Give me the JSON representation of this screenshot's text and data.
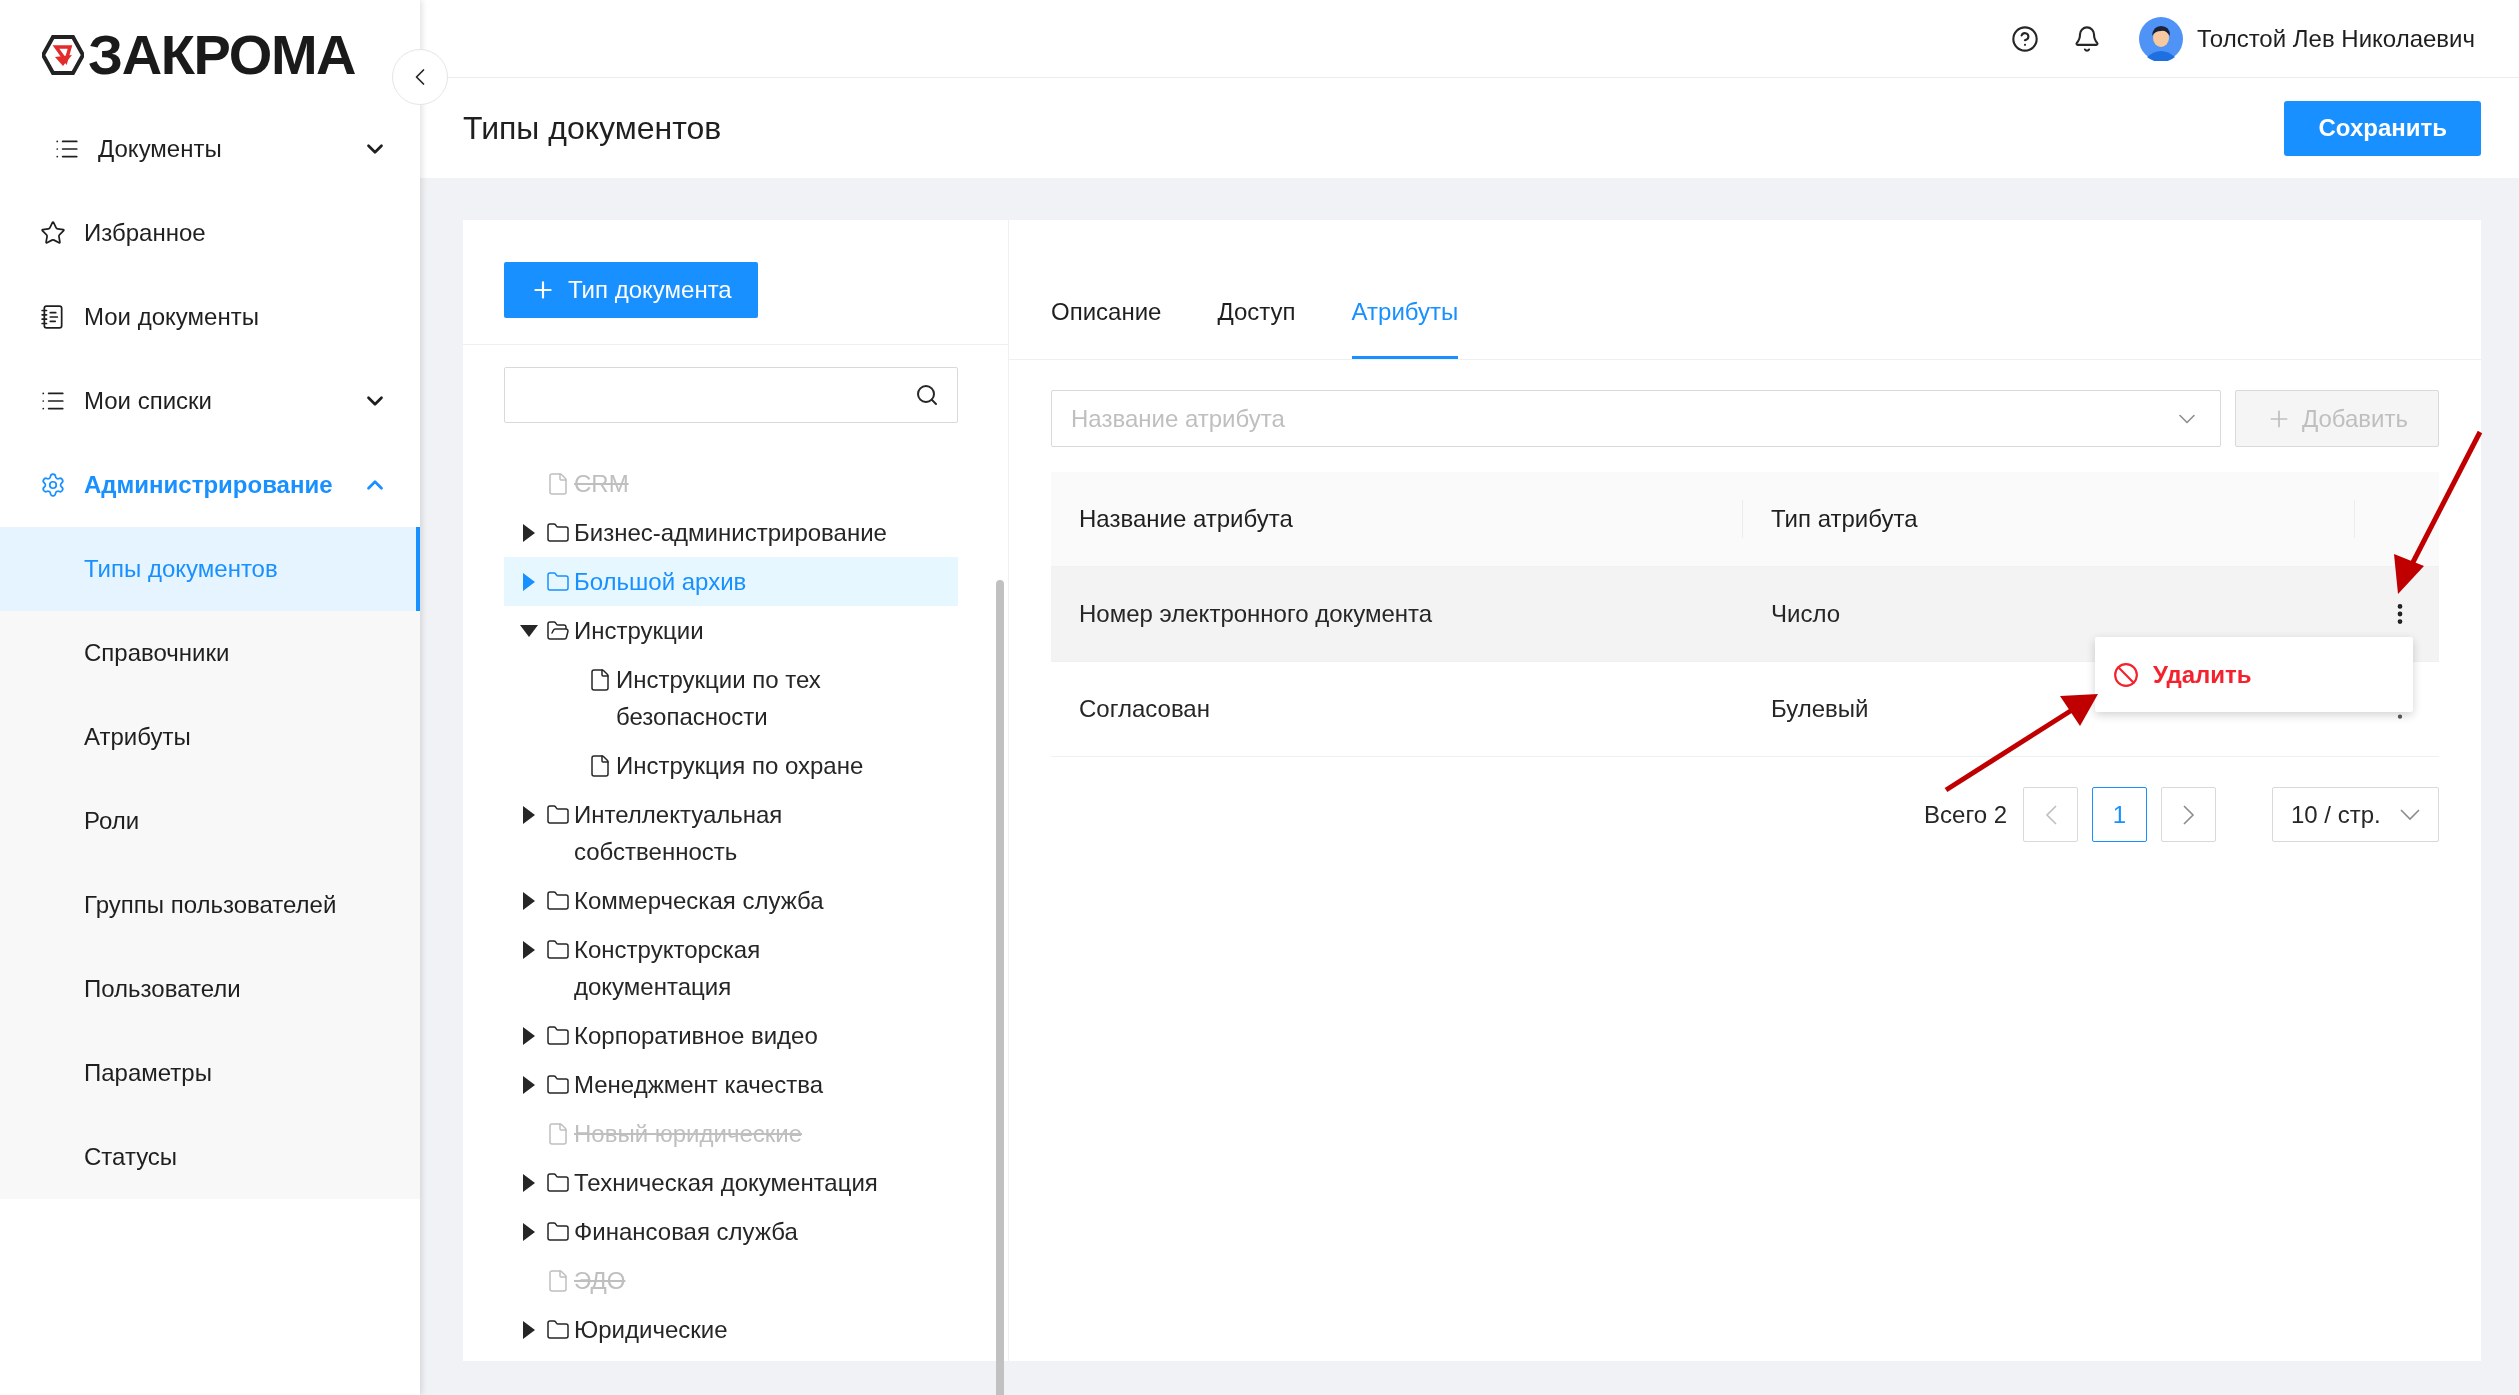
{
  "logo": {
    "text": "ЗАКРОМА"
  },
  "header": {
    "user_name": "Толстой Лев Николаевич"
  },
  "sidebar": {
    "items": [
      {
        "label": "Документы",
        "selected": false,
        "expanded": false
      },
      {
        "label": "Избранное",
        "selected": false
      },
      {
        "label": "Мои документы",
        "selected": false
      },
      {
        "label": "Мои списки",
        "selected": false,
        "expanded": false
      },
      {
        "label": "Администрирование",
        "selected": true,
        "expanded": true,
        "children": [
          {
            "label": "Типы документов",
            "selected": true
          },
          {
            "label": "Справочники",
            "selected": false
          },
          {
            "label": "Атрибуты",
            "selected": false
          },
          {
            "label": "Роли",
            "selected": false
          },
          {
            "label": "Группы пользователей",
            "selected": false
          },
          {
            "label": "Пользователи",
            "selected": false
          },
          {
            "label": "Параметры",
            "selected": false
          },
          {
            "label": "Статусы",
            "selected": false
          }
        ]
      }
    ]
  },
  "page": {
    "title": "Типы документов",
    "save_button": "Сохранить"
  },
  "tree_panel": {
    "add_button": "Тип документа",
    "tree": [
      {
        "label": "CRM",
        "kind": "file",
        "disabled": true,
        "selected": false
      },
      {
        "label": "Бизнес-администрирование",
        "kind": "folder",
        "expanded": false,
        "disabled": false,
        "selected": false
      },
      {
        "label": "Большой архив",
        "kind": "folder",
        "expanded": false,
        "disabled": false,
        "selected": true
      },
      {
        "label": "Инструкции",
        "kind": "folder",
        "expanded": true,
        "disabled": false,
        "selected": false,
        "children": [
          {
            "label": "Инструкции по тех безопасности",
            "kind": "file",
            "disabled": false,
            "selected": false
          },
          {
            "label": "Инструкция по охране",
            "kind": "file",
            "disabled": false,
            "selected": false
          }
        ]
      },
      {
        "label": "Интеллектуальная собственность",
        "kind": "folder",
        "expanded": false,
        "disabled": false,
        "selected": false
      },
      {
        "label": "Коммерческая служба",
        "kind": "folder",
        "expanded": false,
        "disabled": false,
        "selected": false
      },
      {
        "label": "Конструкторская документация",
        "kind": "folder",
        "expanded": false,
        "disabled": false,
        "selected": false
      },
      {
        "label": "Корпоративное видео",
        "kind": "folder",
        "expanded": false,
        "disabled": false,
        "selected": false
      },
      {
        "label": "Менеджмент качества",
        "kind": "folder",
        "expanded": false,
        "disabled": false,
        "selected": false
      },
      {
        "label": "Новый юридические",
        "kind": "file",
        "disabled": true,
        "selected": false
      },
      {
        "label": "Техническая документация",
        "kind": "folder",
        "expanded": false,
        "disabled": false,
        "selected": false
      },
      {
        "label": "Финансовая служба",
        "kind": "folder",
        "expanded": false,
        "disabled": false,
        "selected": false
      },
      {
        "label": "ЭДО",
        "kind": "file",
        "disabled": true,
        "selected": false
      },
      {
        "label": "Юридические",
        "kind": "folder",
        "expanded": false,
        "disabled": false,
        "selected": false
      }
    ]
  },
  "tabs": [
    {
      "label": "Описание",
      "selected": false
    },
    {
      "label": "Доступ",
      "selected": false
    },
    {
      "label": "Атрибуты",
      "selected": true
    }
  ],
  "attribute_select": {
    "placeholder": "Название атрибута"
  },
  "add_attribute_button": {
    "label": "Добавить",
    "disabled": true
  },
  "table": {
    "columns": [
      "Название атрибута",
      "Тип атрибута"
    ],
    "rows": [
      {
        "cells": [
          "Номер электронного документа",
          "Число"
        ],
        "highlighted": true,
        "menu_open": true
      },
      {
        "cells": [
          "Согласован",
          "Булевый"
        ],
        "highlighted": false,
        "menu_open": false
      }
    ]
  },
  "row_menu": {
    "items": [
      {
        "label": "Удалить"
      }
    ]
  },
  "pagination": {
    "total": "Всего 2",
    "pages": [
      {
        "label": "1",
        "selected": true
      }
    ],
    "prev_disabled": true,
    "page_size": "10 / стр."
  }
}
